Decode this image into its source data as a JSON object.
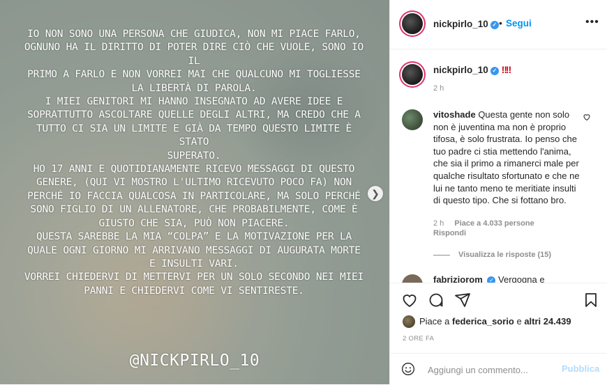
{
  "post": {
    "media_lines": [
      "Io non sono una persona che giudica, non mi piace farlo,",
      "ognuno ha il diritto di poter dire ciò che vuole, sono io il",
      "primo a farlo e non vorrei mai che qualcuno mi togliesse",
      "la libertà di parola.",
      "I miei genitori mi hanno insegnato ad avere idee e",
      "soprattutto ascoltare quelle degli altri, ma credo che a",
      "tutto ci sia un limite e già da tempo questo limite è stato",
      "superato.",
      "Ho 17 anni e quotidianamente ricevo messaggi di questo",
      "genere, (qui vi mostro l'ultimo ricevuto poco fa) non",
      "perché io faccia qualcosa in particolare, ma solo perché",
      "sono figlio di un allenatore, che probabilmente, come è",
      "giusto che sia, può non piacere.",
      "Questa sarebbe la mia “colpa” e la motivazione per la",
      "quale ogni giorno mi arrivano messaggi di augurata morte",
      "e insulti vari.",
      "Vorrei chiedervi di mettervi per un solo secondo nei miei",
      "panni e chiedervi come vi sentireste."
    ],
    "media_handle": "@nickpirlo_10",
    "next_icon": "chevron-right-icon"
  },
  "header": {
    "username": "nickpirlo_10",
    "separator": "•",
    "follow_label": "Segui",
    "more_icon": "•••"
  },
  "caption": {
    "username": "nickpirlo_10",
    "text": "‼‼",
    "time": "2 h"
  },
  "comment": {
    "username": "vitoshade",
    "text": "Questa gente non solo non è juventina ma non è proprio tifosa, è solo frustrata. Io penso che tuo padre ci stia mettendo l'anima, che sia il primo a rimanerci male per qualche risultato sfortunato e che ne lui ne tanto meno te meritiate insulti di questo tipo. Che si fottano bro.",
    "time": "2 h",
    "likes": "Piace a 4.033 persone",
    "reply_label": "Rispondi",
    "view_replies": "Visualizza le risposte (15)"
  },
  "comment2": {
    "username": "fabriziorom",
    "text": "Vergogna e"
  },
  "actions": {
    "liked_prefix": "Piace a ",
    "liked_user": "federica_sorio",
    "liked_mid": " e ",
    "liked_others": "altri 24.439",
    "post_time": "2 ORE FA"
  },
  "add_comment": {
    "placeholder": "Aggiungi un commento...",
    "publish_label": "Pubblica"
  },
  "colors": {
    "accent": "#0095f6",
    "verified": "#3897f0",
    "publish_disabled": "#b3dbff"
  }
}
